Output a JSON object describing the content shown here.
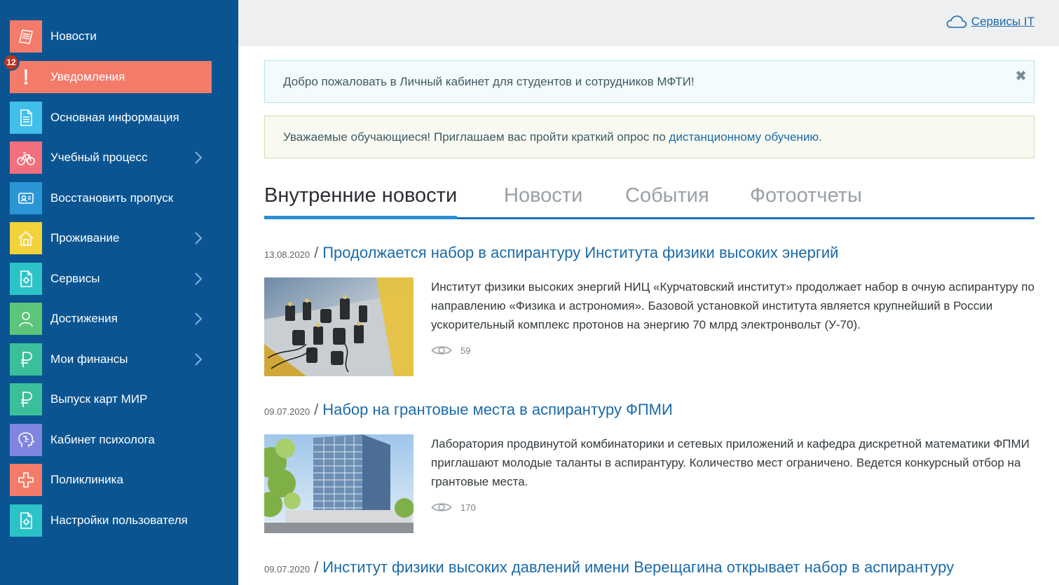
{
  "sidebar": {
    "items": [
      {
        "label": "Новости",
        "icon": "newspaper-icon",
        "color": "#f47b6a",
        "chevron": false
      },
      {
        "label": "Уведомления",
        "icon": "exclamation-icon",
        "color": "#f47b6a",
        "chevron": false,
        "badge": "12",
        "active": true
      },
      {
        "label": "Основная информация",
        "icon": "document-icon",
        "color": "#3fbfe9",
        "chevron": false
      },
      {
        "label": "Учебный процесс",
        "icon": "bicycle-icon",
        "color": "#f2707e",
        "chevron": true
      },
      {
        "label": "Восстановить пропуск",
        "icon": "id-card-icon",
        "color": "#2b95d6",
        "chevron": false
      },
      {
        "label": "Проживание",
        "icon": "house-icon",
        "color": "#f2d33a",
        "chevron": true
      },
      {
        "label": "Сервисы",
        "icon": "gear-document-icon",
        "color": "#2cc3c8",
        "chevron": true
      },
      {
        "label": "Достижения",
        "icon": "person-icon",
        "color": "#5cc57a",
        "chevron": true
      },
      {
        "label": "Мои финансы",
        "icon": "ruble-icon",
        "color": "#3bbf9a",
        "chevron": true
      },
      {
        "label": "Выпуск карт МИР",
        "icon": "ruble-icon",
        "color": "#3bbf9a",
        "chevron": false
      },
      {
        "label": "Кабинет психолога",
        "icon": "brain-icon",
        "color": "#7f86e0",
        "chevron": false
      },
      {
        "label": "Поликлиника",
        "icon": "cross-icon",
        "color": "#f47b6a",
        "chevron": false
      },
      {
        "label": "Настройки пользователя",
        "icon": "gear-document-icon",
        "color": "#2cc3c8",
        "chevron": false
      }
    ]
  },
  "topbar": {
    "services_label": "Сервисы IT"
  },
  "alerts": {
    "info_text": "Добро пожаловать в Личный кабинет для студентов и сотрудников МФТИ!",
    "close_symbol": "✖",
    "success_text": "Уважаемые обучающиеся! Приглашаем вас пройти краткий опрос по ",
    "success_link": "дистанционному обучению",
    "success_end": "."
  },
  "tabs": [
    {
      "label": "Внутренние новости",
      "active": true
    },
    {
      "label": "Новости",
      "active": false
    },
    {
      "label": "События",
      "active": false
    },
    {
      "label": "Фотоотчеты",
      "active": false
    }
  ],
  "news": [
    {
      "date": "13.08.2020",
      "title": "Продолжается набор в аспирантуру Института физики высоких энергий",
      "text": "Институт физики высоких энергий НИЦ «Курчатовский институт» продолжает набор в очную аспирантуру по направлению «Физика и астрономия». Базовой установкой института является крупнейший в России ускорительный комплекс протонов на энергию 70 млрд электронвольт (У-70).",
      "views": "59",
      "image": "laboratory-optics"
    },
    {
      "date": "09.07.2020",
      "title": "Набор на грантовые места в аспирантуру ФПМИ",
      "text": "Лаборатория продвинутой комбинаторики и сетевых приложений и кафедра дискретной математики ФПМИ приглашают молодые таланты в аспирантуру. Количество мест ограничено. Ведется конкурсный отбор на грантовые места.",
      "views": "170",
      "image": "tall-building"
    },
    {
      "date": "09.07.2020",
      "title": "Институт физики высоких давлений имени Верещагина открывает набор в аспирантуру"
    }
  ],
  "separator": "/"
}
